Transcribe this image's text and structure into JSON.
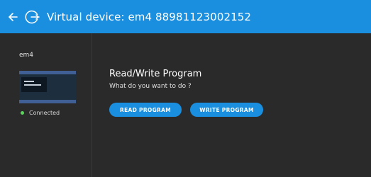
{
  "titlebar": {
    "title": "Virtual device: em4 88981123002152",
    "back_icon": "arrow-left-icon",
    "device_icon": "device-connection-icon",
    "accent_color": "#1a8fe0"
  },
  "sidebar": {
    "device_name": "em4",
    "status": "Connected",
    "status_color": "#5bd35b"
  },
  "main": {
    "title": "Read/Write Program",
    "subtitle": "What do you want to do ?",
    "read_button": "READ PROGRAM",
    "write_button": "WRITE PROGRAM"
  }
}
